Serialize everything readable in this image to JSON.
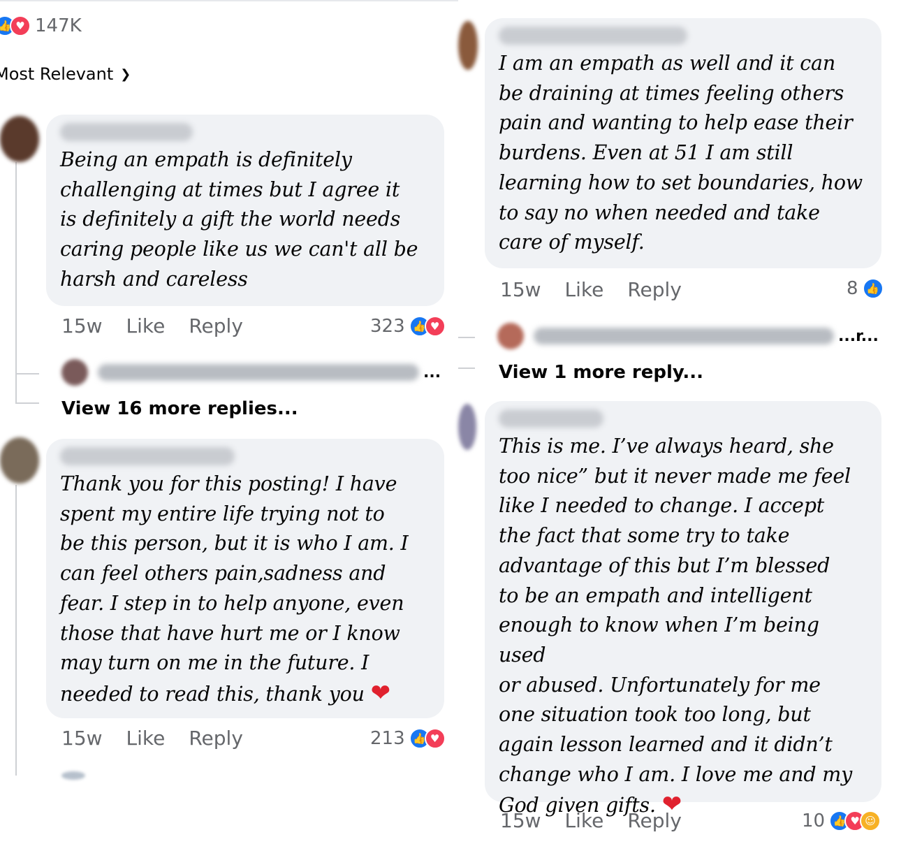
{
  "header": {
    "reaction_count": "147K",
    "sort_label": "Most Relevant"
  },
  "comments": [
    {
      "text": "Being an empath is definitely\nchallenging at times but I agree it\nis definitely a gift the world needs\ncaring people like us we can't all be\nharsh and careless",
      "time": "15w",
      "like_label": "Like",
      "reply_label": "Reply",
      "reaction_count": "323",
      "reactions": [
        "like-icon",
        "love-icon"
      ],
      "view_more": "View 16 more replies..."
    },
    {
      "text": "Thank you for this posting! I have\nspent my entire life trying not to\nbe this person, but it is who I am. I\ncan feel others pain,sadness and\nfear. I step in to help anyone, even\nthose that have hurt me or I know\nmay turn on me in the future. I\nneeded to read this, thank you",
      "emoji": "❤",
      "time": "15w",
      "like_label": "Like",
      "reply_label": "Reply",
      "reaction_count": "213",
      "reactions": [
        "like-icon",
        "love-icon"
      ]
    },
    {
      "text": "I am an empath as well and it can\nbe draining at times feeling others\npain and wanting to help ease their\nburdens. Even at 51 I am still\nlearning how to set boundaries, how\nto say no when needed and take\ncare of myself.",
      "time": "15w",
      "like_label": "Like",
      "reply_label": "Reply",
      "reaction_count": "8",
      "reactions": [
        "like-icon"
      ],
      "reply_preview_suffix": "...r...",
      "view_more": "View 1 more reply..."
    },
    {
      "text": "This is me. I’ve always heard, she\ntoo nice” but it never made me feel\nlike I needed to change. I accept\nthe fact that some try to take\nadvantage of this but I’m blessed\nto be an empath and intelligent\nenough to know when I’m being used\nor abused. Unfortunately for me\none situation took too long, but\nagain lesson learned and it didn’t\nchange who I am. I love me and my\nGod given gifts.",
      "emoji": "❤",
      "time": "15w",
      "like_label": "Like",
      "reply_label": "Reply",
      "reaction_count": "10",
      "reactions": [
        "like-icon",
        "love-icon",
        "care-icon"
      ]
    }
  ],
  "ellipsis": "...",
  "colors": {
    "bubble": "#f0f2f5",
    "meta_text": "#65676b",
    "like_blue": "#1877f2",
    "love_red": "#f33e58",
    "care_yellow": "#f7b125"
  }
}
